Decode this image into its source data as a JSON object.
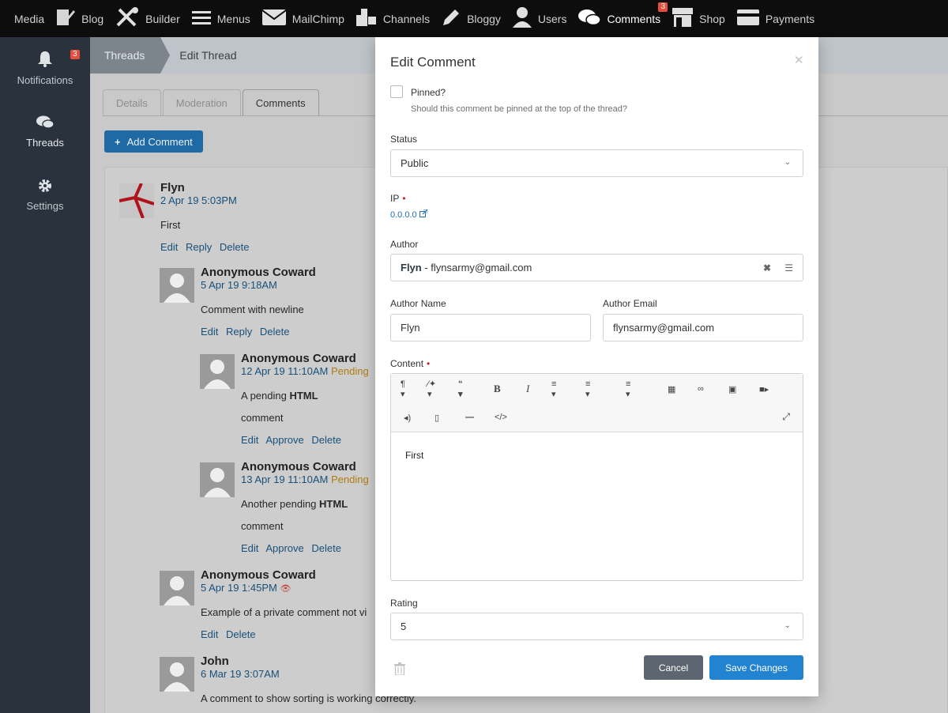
{
  "topnav": {
    "items": [
      {
        "label": "Media",
        "icon": ""
      },
      {
        "label": "Blog",
        "icon": "blog-icon"
      },
      {
        "label": "Builder",
        "icon": "tools-icon"
      },
      {
        "label": "Menus",
        "icon": "menu-icon"
      },
      {
        "label": "MailChimp",
        "icon": "mail-icon"
      },
      {
        "label": "Channels",
        "icon": "channels-icon"
      },
      {
        "label": "Bloggy",
        "icon": "pencil-icon"
      },
      {
        "label": "Users",
        "icon": "user-icon"
      },
      {
        "label": "Comments",
        "icon": "comments-icon",
        "badge": "3"
      },
      {
        "label": "Shop",
        "icon": "shop-icon"
      },
      {
        "label": "Payments",
        "icon": "card-icon"
      }
    ]
  },
  "sidebar": {
    "items": [
      {
        "label": "Notifications",
        "icon": "bell-icon",
        "badge": "3"
      },
      {
        "label": "Threads",
        "icon": "comments-icon"
      },
      {
        "label": "Settings",
        "icon": "gear-icon"
      }
    ]
  },
  "breadcrumb": {
    "items": [
      "Threads",
      "Edit Thread"
    ]
  },
  "tabs": {
    "items": [
      "Details",
      "Moderation",
      "Comments"
    ],
    "active": "Comments"
  },
  "add_comment": {
    "label": "Add Comment"
  },
  "comments": [
    {
      "author": "Flyn",
      "date": "2 Apr 19 5:03PM",
      "lines": [
        "First"
      ],
      "actions": [
        "Edit",
        "Reply",
        "Delete"
      ]
    },
    {
      "author": "Anonymous Coward",
      "date": "5 Apr 19 9:18AM",
      "lines": [
        "Comment with newline"
      ],
      "actions": [
        "Edit",
        "Reply",
        "Delete"
      ]
    },
    {
      "author": "Anonymous Coward",
      "date": "12 Apr 19 11:10AM",
      "status": "Pending",
      "lines_html": [
        [
          "A pending ",
          "HTML"
        ],
        [
          "comment"
        ]
      ],
      "actions": [
        "Edit",
        "Approve",
        "Delete"
      ]
    },
    {
      "author": "Anonymous Coward",
      "date": "13 Apr 19 11:10AM",
      "status": "Pending",
      "lines_html": [
        [
          "Another pending ",
          "HTML"
        ],
        [
          "comment"
        ]
      ],
      "actions": [
        "Edit",
        "Approve",
        "Delete"
      ]
    },
    {
      "author": "Anonymous Coward",
      "date": "5 Apr 19 1:45PM",
      "lines": [
        "Example of a private comment not vi"
      ],
      "actions": [
        "Edit",
        "Delete"
      ]
    },
    {
      "author": "John",
      "date": "6 Mar 19 3:07AM",
      "lines": [
        "A comment to show sorting is working correctly."
      ]
    }
  ],
  "modal": {
    "title": "Edit Comment",
    "pinned": {
      "label": "Pinned?",
      "help": "Should this comment be pinned at the top of the thread?",
      "checked": false
    },
    "status": {
      "label": "Status",
      "value": "Public"
    },
    "ip": {
      "label": "IP",
      "value": "0.0.0.0"
    },
    "author": {
      "label": "Author",
      "name": "Flyn",
      "separator": " - ",
      "email": "flynsarmy@gmail.com"
    },
    "author_name": {
      "label": "Author Name",
      "value": "Flyn"
    },
    "author_email": {
      "label": "Author Email",
      "value": "flynsarmy@gmail.com"
    },
    "content": {
      "label": "Content",
      "value": "First"
    },
    "rating": {
      "label": "Rating",
      "value": "5"
    },
    "cancel_label": "Cancel",
    "save_label": "Save Changes"
  }
}
